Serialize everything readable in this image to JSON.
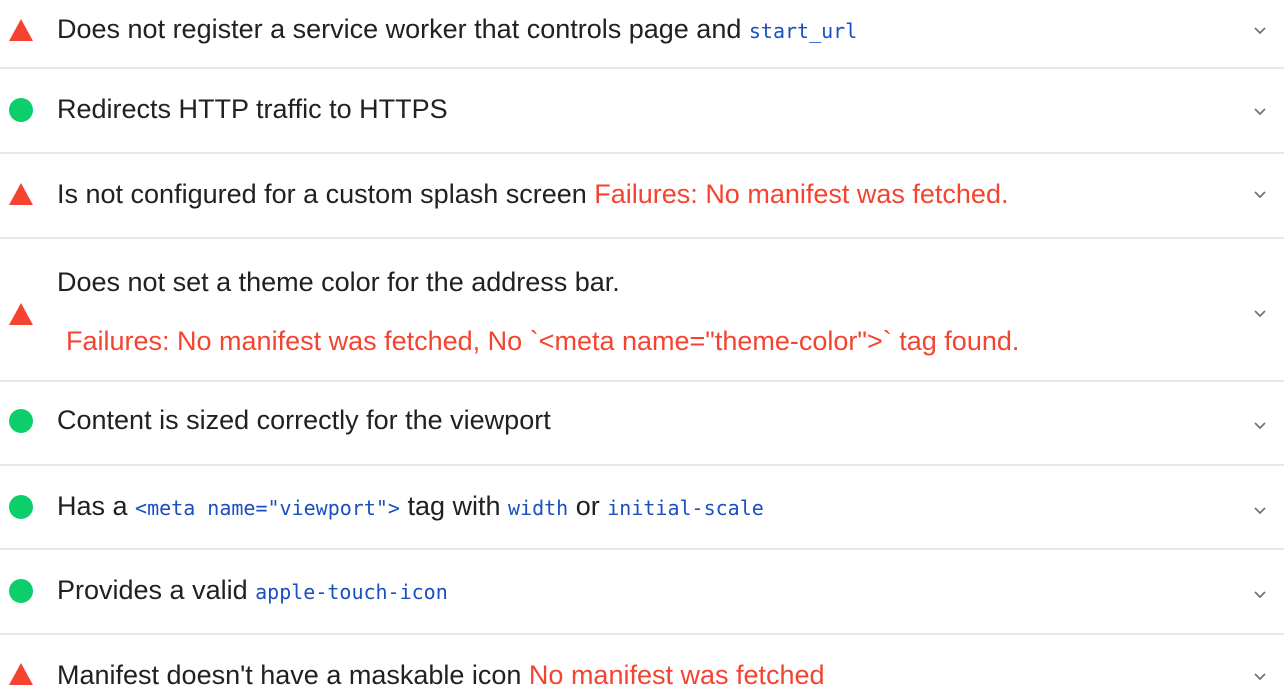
{
  "colors": {
    "fail": "#f4442f",
    "pass": "#0cce6b",
    "code": "#1a4fbf",
    "divider": "#e8e8e8",
    "chevron": "#757575"
  },
  "audits": [
    {
      "status_icon": "fail-triangle-icon",
      "title_prefix": "Does not register a service worker that controls page and ",
      "title_code": "start_url"
    },
    {
      "status_icon": "pass-circle-icon",
      "title": "Redirects HTTP traffic to HTTPS"
    },
    {
      "status_icon": "fail-triangle-icon",
      "title": "Is not configured for a custom splash screen ",
      "failure": "Failures: No manifest was fetched."
    },
    {
      "status_icon": "fail-triangle-icon",
      "title": "Does not set a theme color for the address bar.",
      "failure": "Failures: No manifest was fetched, No `<meta name=\"theme-color\">` tag found."
    },
    {
      "status_icon": "pass-circle-icon",
      "title": "Content is sized correctly for the viewport"
    },
    {
      "status_icon": "pass-circle-icon",
      "title_prefix": "Has a ",
      "code_1": "<meta name=\"viewport\">",
      "title_mid": " tag with ",
      "code_2": "width",
      "title_or": " or ",
      "code_3": "initial-scale"
    },
    {
      "status_icon": "pass-circle-icon",
      "title_prefix": "Provides a valid ",
      "title_code": "apple-touch-icon"
    },
    {
      "status_icon": "fail-triangle-icon",
      "title": "Manifest doesn't have a maskable icon ",
      "failure": "No manifest was fetched"
    }
  ]
}
